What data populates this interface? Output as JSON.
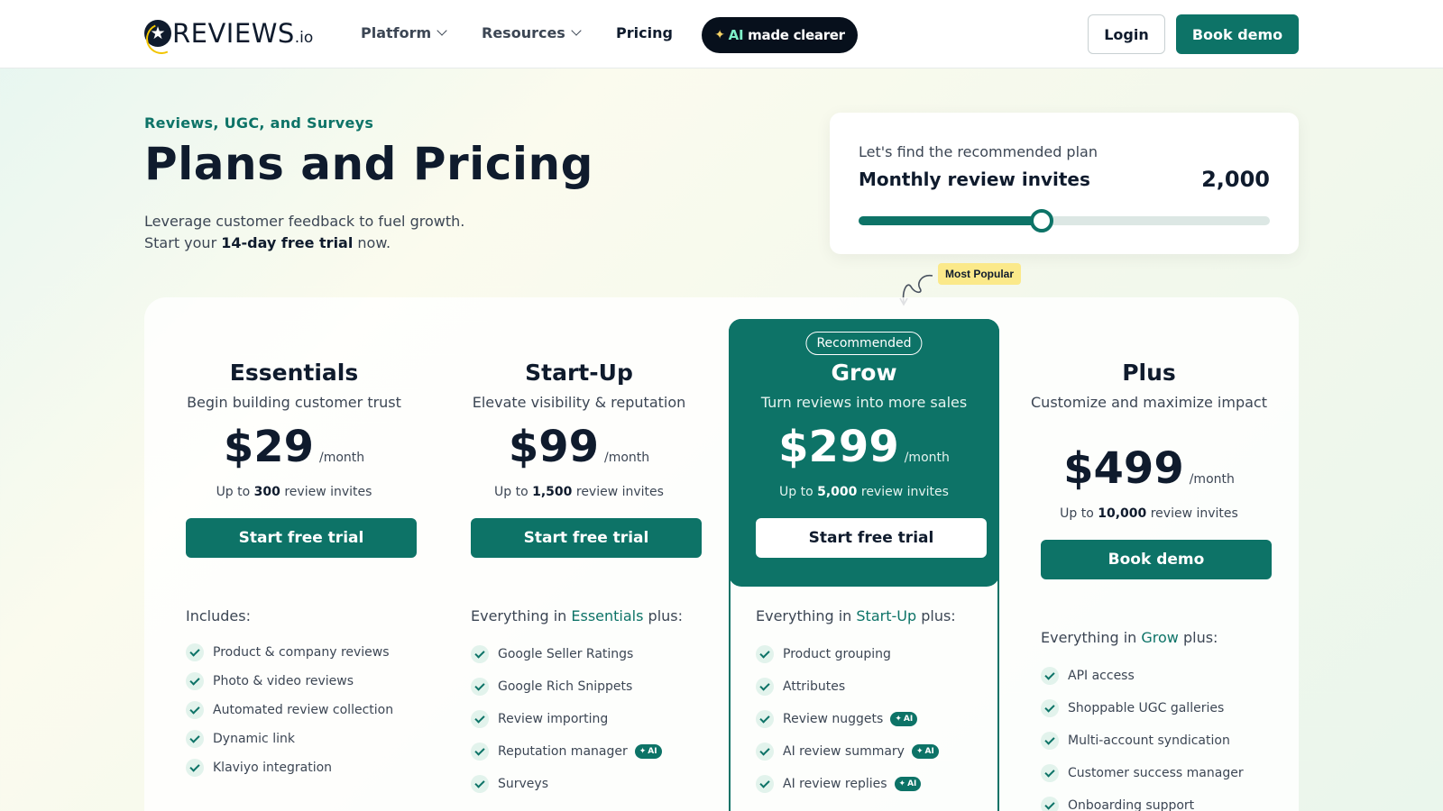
{
  "nav": {
    "logo_text": "REVIEWS",
    "logo_suffix": ".io",
    "platform": "Platform",
    "resources": "Resources",
    "pricing": "Pricing",
    "ai_pill": {
      "prefix": "AI",
      "middle": " made ",
      "suffix": "clearer"
    },
    "login": "Login",
    "book_demo": "Book demo"
  },
  "hero": {
    "eyebrow": "Reviews, UGC, and Surveys",
    "title": "Plans and Pricing",
    "line1": "Leverage customer feedback to fuel growth.",
    "line2_pre": "Start your ",
    "line2_bold": "14-day free trial",
    "line2_post": " now."
  },
  "recommender": {
    "caption": "Let's find the recommended plan",
    "label": "Monthly review invites",
    "value": "2,000",
    "slider_fraction": 0.445
  },
  "most_popular": "Most Popular",
  "recommended_badge": "Recommended",
  "plans": [
    {
      "name": "Essentials",
      "desc": "Begin building customer trust",
      "price": "$29",
      "per": "/month",
      "invites_pre": "Up to ",
      "invites_num": "300",
      "invites_post": " review invites",
      "cta": "Start free trial",
      "includes": "Includes:",
      "features": [
        "Product & company reviews",
        "Photo & video reviews",
        "Automated review collection",
        "Dynamic link",
        "Klaviyo integration"
      ]
    },
    {
      "name": "Start-Up",
      "desc": "Elevate visibility & reputation",
      "price": "$99",
      "per": "/month",
      "invites_pre": "Up to ",
      "invites_num": "1,500",
      "invites_post": " review invites",
      "cta": "Start free trial",
      "includes_pre": "Everything in ",
      "includes_link": "Essentials",
      "includes_post": " plus:",
      "features": [
        "Google Seller Ratings",
        "Google Rich Snippets",
        "Review importing",
        "Reputation manager",
        "Surveys"
      ]
    },
    {
      "name": "Grow",
      "desc": "Turn reviews into more sales",
      "price": "$299",
      "per": "/month",
      "invites_pre": "Up to ",
      "invites_num": "5,000",
      "invites_post": " review invites",
      "cta": "Start free trial",
      "includes_pre": "Everything in ",
      "includes_link": "Start-Up",
      "includes_post": " plus:",
      "features": [
        "Product grouping",
        "Attributes",
        "Review nuggets",
        "AI review summary",
        "AI review replies"
      ]
    },
    {
      "name": "Plus",
      "desc": "Customize and maximize impact",
      "price": "$499",
      "per": "/month",
      "invites_pre": "Up to ",
      "invites_num": "10,000",
      "invites_post": " review invites",
      "cta": "Book demo",
      "includes_pre": "Everything in ",
      "includes_link": "Grow",
      "includes_post": " plus:",
      "features": [
        "API access",
        "Shoppable UGC galleries",
        "Multi-account syndication",
        "Customer success manager",
        "Onboarding support"
      ]
    }
  ],
  "ai_badge": "AI",
  "colors": {
    "brand": "#0d7367",
    "dark": "#0f1b2d",
    "highlight": "#fbe98a"
  }
}
